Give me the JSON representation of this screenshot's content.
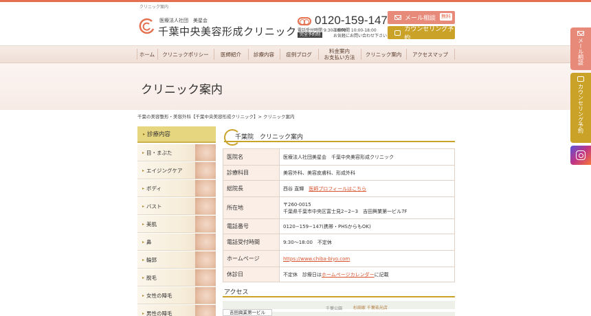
{
  "top_breadcrumb": "クリニック案内",
  "header": {
    "org": "医療法人社団　美星会",
    "clinic_name": "千葉中央美容形成クリニック",
    "tel": "0120-159-147",
    "hours_reception": "電話受付時間 9:30-18:00",
    "hours_clinic": "診療時間 10:00-18:00",
    "reservation_badge": "完全予約制",
    "reservation_note": "お気軽にお問い合わせ下さい",
    "mail_button": "メール相談",
    "mail_free_badge": "無料",
    "counsel_button": "カウンセリング予約"
  },
  "nav": [
    {
      "label": "ホーム"
    },
    {
      "label": "クリニックポリシー"
    },
    {
      "label": "医師紹介"
    },
    {
      "label": "診療内容"
    },
    {
      "label": "症例ブログ"
    },
    {
      "label": "料金案内\nお支払い方法"
    },
    {
      "label": "クリニック案内"
    },
    {
      "label": "アクセスマップ"
    }
  ],
  "page_title": "クリニック案内",
  "breadcrumb": "千葉の美容整形・美容外科【千葉中央美容形成クリニック】> クリニック案内",
  "sidebar": {
    "heading": "診療内容",
    "items": [
      {
        "label": "目・まぶた"
      },
      {
        "label": "エイジングケア"
      },
      {
        "label": "ボディ"
      },
      {
        "label": "バスト"
      },
      {
        "label": "美肌"
      },
      {
        "label": "鼻"
      },
      {
        "label": "輪郭"
      },
      {
        "label": "脱毛"
      },
      {
        "label": "女性の陣毛"
      },
      {
        "label": "男性の陣毛"
      }
    ]
  },
  "section_title": "千葉院　クリニック案内",
  "info_table": [
    {
      "label": "医院名",
      "value": "医療法人社団美星会　千葉中央美容形成クリニック"
    },
    {
      "label": "診療科目",
      "value": "美容外科、美容皮膚科、形成外科"
    },
    {
      "label": "総院長",
      "value": "西谷 直輝",
      "link": "医師プロフィールはこちら"
    },
    {
      "label": "所在地",
      "value": "〒260-0015",
      "value2": "千葉県千葉市中央区富士見2−2−3　吉田興業第一ビル7F"
    },
    {
      "label": "電話番号",
      "value": "0120−159−147(携帯・PHSからもOK)"
    },
    {
      "label": "電話受付時間",
      "value": "9:30〜18:00　不定休"
    },
    {
      "label": "ホームページ",
      "link": "https://www.chiba-biyo.com"
    },
    {
      "label": "休診日",
      "value": "不定休　診療日は",
      "link": "ホームページカレンダー",
      "value_after": "に記載"
    }
  ],
  "access_title": "アクセス",
  "map": {
    "pin_label": "吉田興業第一ビル",
    "label1": "千葉公園",
    "label2": "杉田家 千葉祐光店"
  },
  "right_tabs": {
    "mail": "メール相談",
    "counsel": "カウンセリング予約"
  },
  "colors": {
    "accent_orange": "#e4704f",
    "gold": "#c9a227",
    "salmon": "#e88a7a"
  }
}
